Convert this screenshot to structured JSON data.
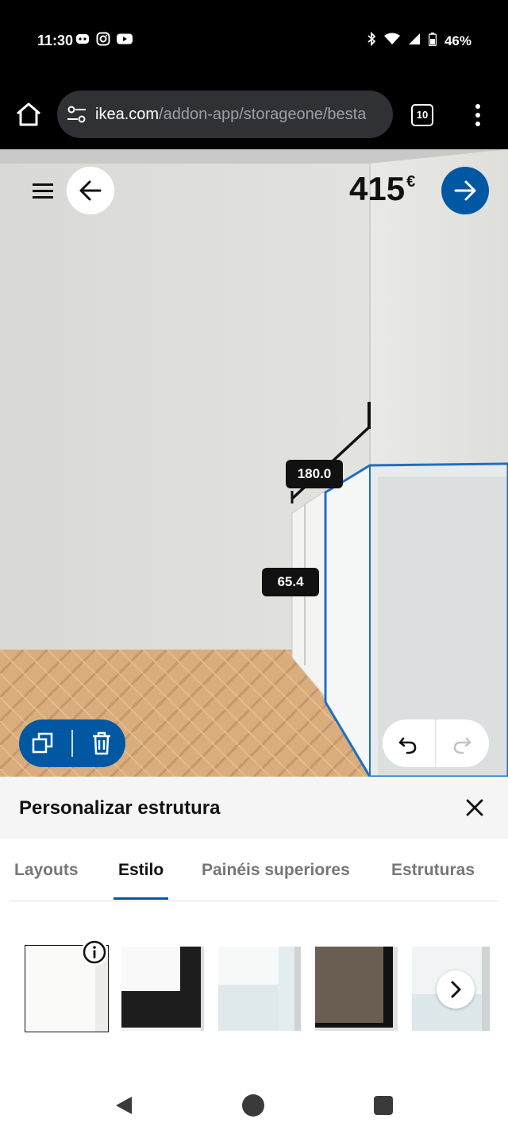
{
  "status_bar": {
    "time": "11:30",
    "battery": "46%"
  },
  "browser": {
    "url_host": "ikea.com",
    "url_path": "/addon-app/storageone/besta",
    "tab_count": "10"
  },
  "planner": {
    "price": "415",
    "currency": "€",
    "dimension_width": "180.0",
    "dimension_height": "65.4"
  },
  "panel": {
    "title": "Personalizar estrutura",
    "tabs": [
      {
        "label": "Layouts"
      },
      {
        "label": "Estilo"
      },
      {
        "label": "Painéis superiores"
      },
      {
        "label": "Estruturas"
      }
    ],
    "active_tab": "Estilo"
  },
  "colors": {
    "ikea_blue": "#0058a3",
    "selection_outline": "#1f6fc0"
  }
}
